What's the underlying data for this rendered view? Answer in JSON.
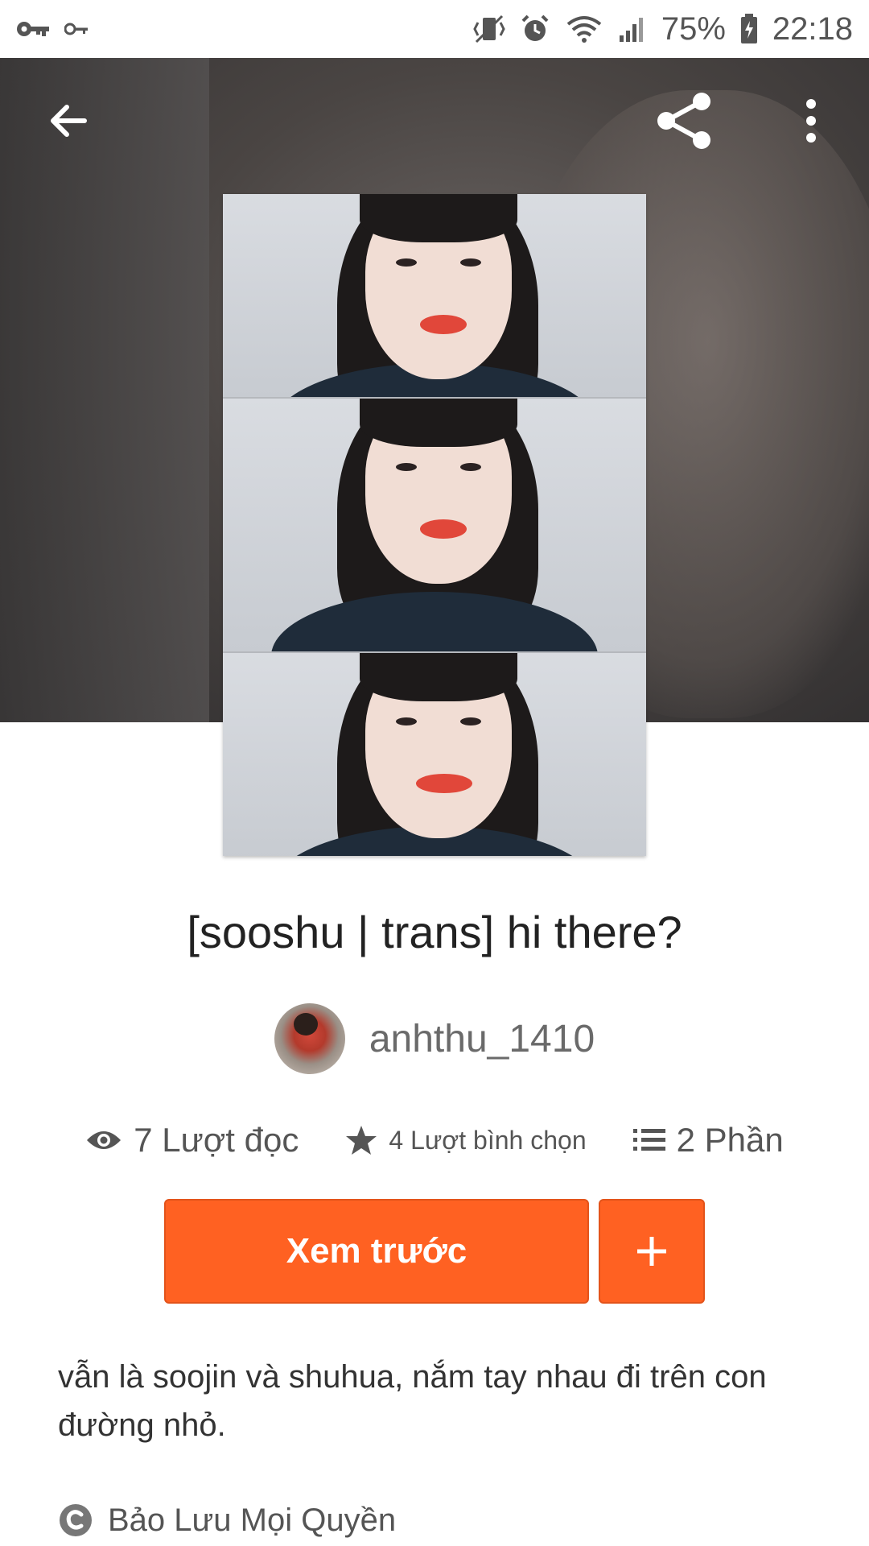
{
  "status_bar": {
    "battery": "75%",
    "time": "22:18"
  },
  "toolbar": {
    "back_icon": "arrow-left-icon",
    "share_icon": "share-icon",
    "more_icon": "more-vert-icon"
  },
  "story": {
    "title": "[sooshu | trans] hi there?",
    "author": "anhthu_1410",
    "stats": {
      "reads": "7 Lượt đọc",
      "votes": "4 Lượt bình chọn",
      "parts": "2 Phần"
    },
    "read_button": "Xem trước",
    "add_button": "+",
    "description": "vẫn là soojin và shuhua, nắm tay nhau đi trên con đường nhỏ.",
    "copyright": "Bảo Lưu Mọi Quyền"
  },
  "colors": {
    "accent": "#ff6122",
    "text": "#222222",
    "muted": "#6a6a6a"
  }
}
